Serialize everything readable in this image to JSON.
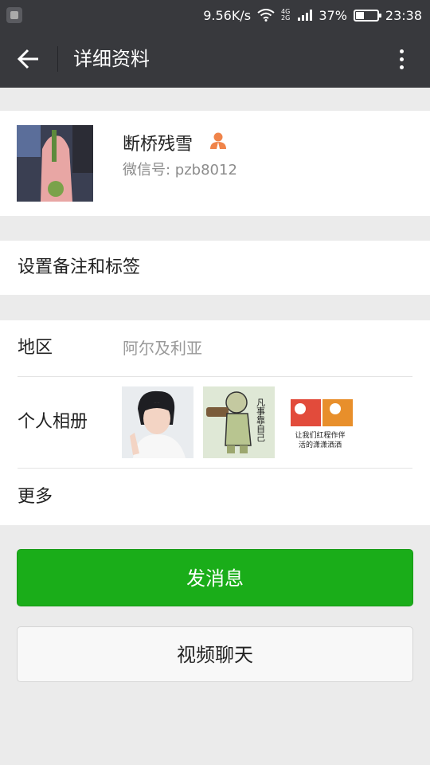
{
  "status_bar": {
    "net_speed": "9.56K/s",
    "network_tag_top": "4G",
    "network_tag_bottom": "2G",
    "battery_percent": "37%",
    "battery_level": 0.37,
    "time": "23:38"
  },
  "header": {
    "title": "详细资料",
    "back_icon": "arrow-left-icon",
    "menu_icon": "more-vertical-icon"
  },
  "profile": {
    "nickname": "断桥残雪",
    "gender_icon": "person-icon",
    "wechat_id": "微信号: pzb8012"
  },
  "remark": {
    "label": "设置备注和标签"
  },
  "info": {
    "region_label": "地区",
    "region_value": "阿尔及利亚",
    "album_label": "个人相册",
    "album_thumb3_text": "让我们红程作伴 活的潇潇洒洒",
    "album_thumb2_text": "凡事靠自己",
    "more_label": "更多"
  },
  "actions": {
    "send_message": "发消息",
    "video_chat": "视频聊天"
  },
  "colors": {
    "header_bg": "#38393d",
    "accent_green": "#1aad19",
    "page_bg": "#ebebeb"
  }
}
